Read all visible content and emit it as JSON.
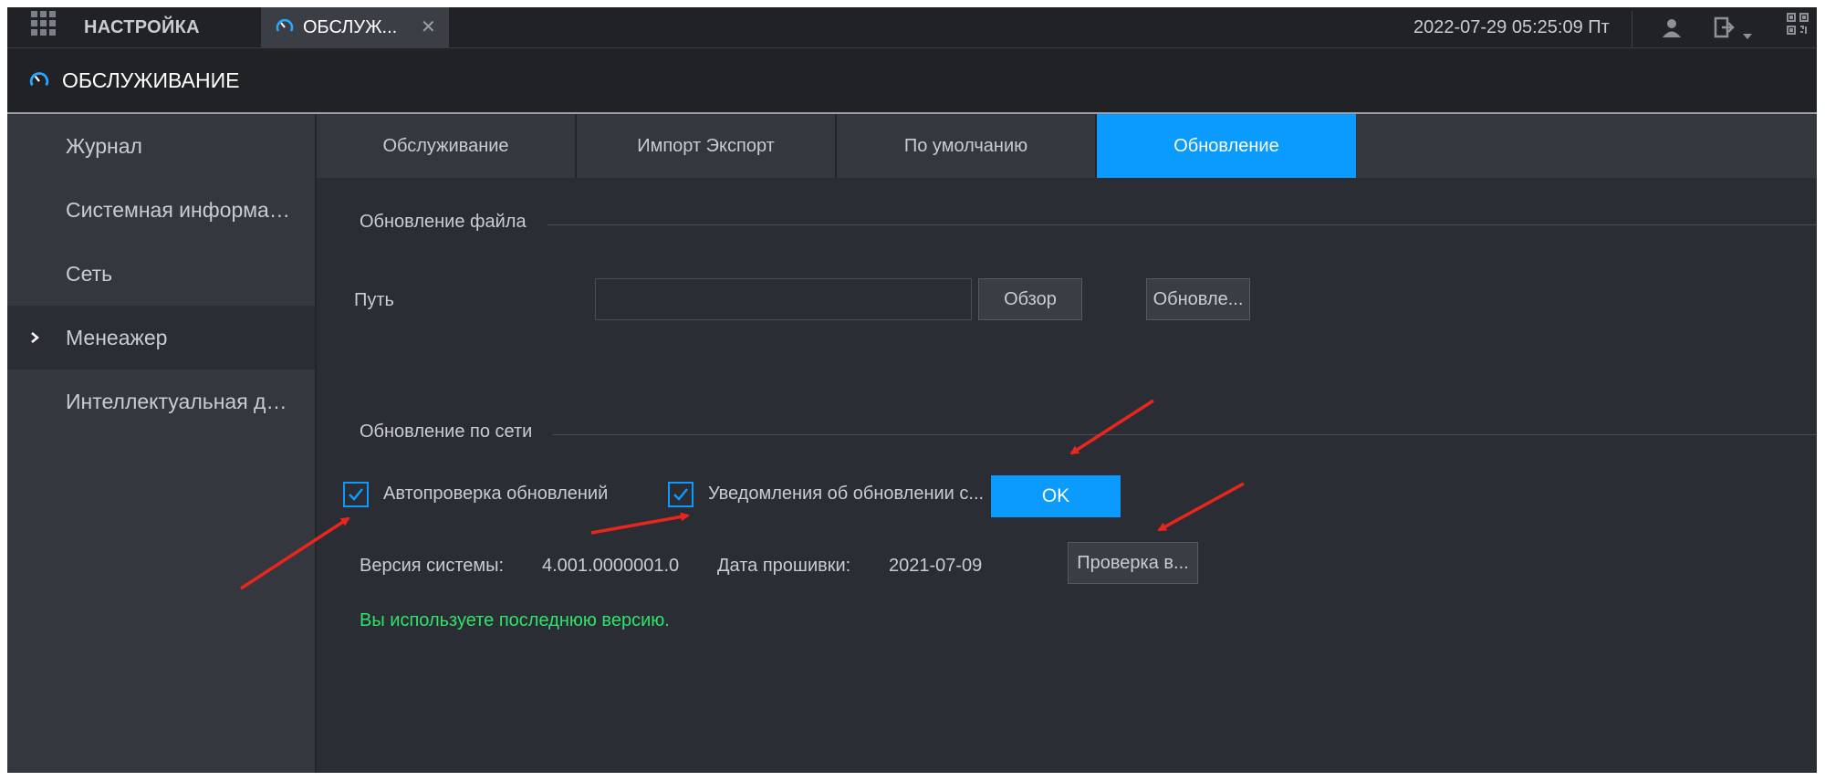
{
  "topbar": {
    "setup_label": "НАСТРОЙКА",
    "active_tab_label": "ОБСЛУЖ...",
    "close_glyph": "✕",
    "datetime": "2022-07-29 05:25:09 Пт",
    "icons": [
      "grid-menu-icon",
      "gauge-icon",
      "close-icon",
      "user-icon",
      "logout-icon",
      "caret-down-icon",
      "qr-code-icon"
    ]
  },
  "header": {
    "title": "ОБСЛУЖИВАНИЕ"
  },
  "sidebar": {
    "items": [
      {
        "label": "Журнал"
      },
      {
        "label": "Системная информация"
      },
      {
        "label": "Сеть"
      },
      {
        "label": "Менеажер",
        "active": true
      },
      {
        "label": "Интеллектуальная диагностика"
      }
    ],
    "chevron": "›"
  },
  "tabs": [
    {
      "label": "Обслуживание"
    },
    {
      "label": "Импорт Экспорт"
    },
    {
      "label": "По умолчанию"
    },
    {
      "label": "Обновление",
      "active": true
    }
  ],
  "file_update": {
    "section_title": "Обновление файла",
    "path_label": "Путь",
    "path_value": "",
    "browse_label": "Обзор",
    "update_label": "Обновле..."
  },
  "network_update": {
    "section_title": "Обновление по сети",
    "auto_check": {
      "label": "Автопроверка обновлений",
      "checked": true
    },
    "notify": {
      "label": "Уведомления об обновлении с...",
      "checked": true
    },
    "ok_label": "OK",
    "version_label": "Версия системы:",
    "version_value": "4.001.0000001.0",
    "firmware_date_label": "Дата прошивки:",
    "firmware_date_value": "2021-07-09",
    "check_label": "Проверка в...",
    "status_text": "Вы используете последнюю версию."
  },
  "colors": {
    "accent": "#0b9bff",
    "success": "#2ee36b",
    "annotation_arrow": "#e8261e",
    "background": "#2a2d33"
  }
}
